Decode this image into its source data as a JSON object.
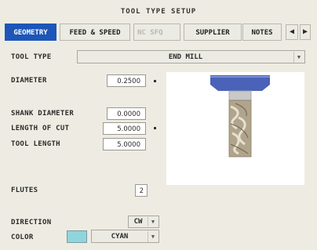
{
  "window": {
    "title": "TOOL TYPE SETUP"
  },
  "tabs": [
    {
      "label": "GEOMETRY",
      "active": true
    },
    {
      "label": "FEED & SPEED",
      "active": false
    },
    {
      "label": "NC SFQ",
      "active": false,
      "disabled": true
    },
    {
      "label": "SUPPLIER",
      "active": false
    },
    {
      "label": "NOTES",
      "active": false
    }
  ],
  "tab_scroll": {
    "left_icon": "arrow-left-icon",
    "right_icon": "arrow-right-icon",
    "left_glyph": "◀",
    "right_glyph": "▶"
  },
  "tool_type": {
    "label": "TOOL TYPE",
    "value": "END MILL"
  },
  "fields": {
    "diameter": {
      "label": "DIAMETER",
      "value": "0.2500"
    },
    "shank_diameter": {
      "label": "SHANK DIAMETER",
      "value": "0.0000"
    },
    "length_of_cut": {
      "label": "LENGTH OF CUT",
      "value": "5.0000"
    },
    "tool_length": {
      "label": "TOOL LENGTH",
      "value": "5.0000"
    },
    "flutes": {
      "label": "FLUTES",
      "value": "2"
    }
  },
  "direction": {
    "label": "DIRECTION",
    "value": "CW"
  },
  "color": {
    "label": "COLOR",
    "value": "CYAN",
    "swatch": "#8fd6dc"
  },
  "colors": {
    "tab_active": "#1d56b8",
    "holder": "#4a62b8",
    "shank": "#c9c9c9",
    "flute_body": "#b0a48c"
  }
}
